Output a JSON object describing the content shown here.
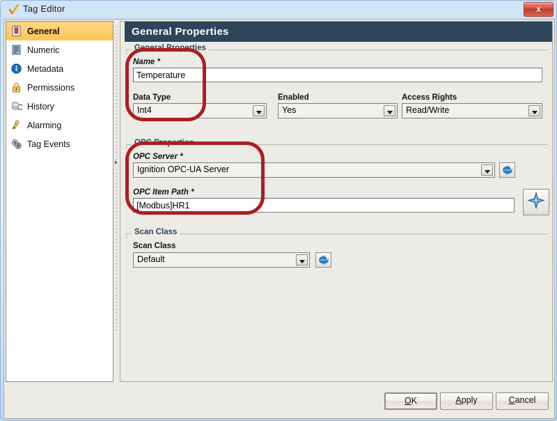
{
  "window": {
    "title": "Tag Editor",
    "title_icon": "checkmark-icon",
    "close_label": "x"
  },
  "sidebar": {
    "items": [
      {
        "label": "General",
        "icon": "document-icon",
        "selected": true
      },
      {
        "label": "Numeric",
        "icon": "numeric-icon",
        "selected": false
      },
      {
        "label": "Metadata",
        "icon": "info-icon",
        "selected": false
      },
      {
        "label": "Permissions",
        "icon": "lock-icon",
        "selected": false
      },
      {
        "label": "History",
        "icon": "history-icon",
        "selected": false
      },
      {
        "label": "Alarming",
        "icon": "bell-icon",
        "selected": false
      },
      {
        "label": "Tag Events",
        "icon": "tag-events-icon",
        "selected": false
      }
    ]
  },
  "panel": {
    "header": "General Properties",
    "groups": {
      "general": {
        "title": "General Properties",
        "name": {
          "label": "Name *",
          "value": "Temperature"
        },
        "data_type": {
          "label": "Data Type",
          "value": "Int4"
        },
        "enabled": {
          "label": "Enabled",
          "value": "Yes"
        },
        "access_rights": {
          "label": "Access Rights",
          "value": "Read/Write"
        }
      },
      "opc": {
        "title": "OPC Properties",
        "server": {
          "label": "OPC Server *",
          "value": "Ignition OPC-UA Server"
        },
        "item_path": {
          "label": "OPC Item Path *",
          "value": "[Modbus]HR1"
        },
        "browse_icon": "globe-browse-icon",
        "add_icon": "add-plus-icon"
      },
      "scan_class": {
        "title": "Scan Class",
        "field": {
          "label": "Scan Class",
          "value": "Default"
        },
        "refresh_icon": "globe-refresh-icon"
      }
    }
  },
  "buttons": {
    "ok": {
      "mnemonic": "O",
      "rest": "K"
    },
    "apply": {
      "mnemonic": "A",
      "rest": "pply"
    },
    "cancel": {
      "mnemonic": "C",
      "rest": "ancel"
    }
  },
  "colors": {
    "header_bg": "#2d4459",
    "selected_item": "#ffcd6d",
    "annotation": "#aa1f24",
    "panel_bg": "#edebe6"
  }
}
